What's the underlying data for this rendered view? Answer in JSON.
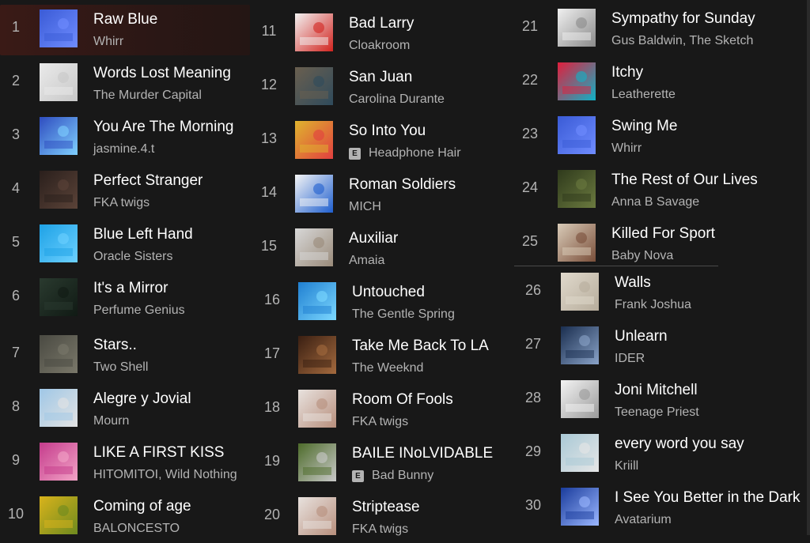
{
  "tracks": [
    {
      "num": "1",
      "title": "Raw Blue",
      "artist": "Whirr",
      "art": "blue-dancer-art",
      "colors": [
        "#3a5bd6",
        "#6f8cff"
      ],
      "active": true
    },
    {
      "num": "2",
      "title": "Words Lost Meaning",
      "artist": "The Murder Capital",
      "art": "white-map-art",
      "colors": [
        "#eaeaea",
        "#c8c8c8"
      ]
    },
    {
      "num": "3",
      "title": "You Are The Morning",
      "artist": "jasmine.4.t",
      "art": "blue-portrait-art",
      "colors": [
        "#2e4cbf",
        "#7fd0ff"
      ]
    },
    {
      "num": "4",
      "title": "Perfect Stranger",
      "artist": "FKA twigs",
      "art": "dark-figure-art",
      "colors": [
        "#2a1f1c",
        "#5b4338"
      ]
    },
    {
      "num": "5",
      "title": "Blue Left Hand",
      "artist": "Oracle Sisters",
      "art": "cyan-logo-art",
      "colors": [
        "#1ea2e6",
        "#6cd0ff"
      ]
    },
    {
      "num": "6",
      "title": "It's a Mirror",
      "artist": "Perfume Genius",
      "art": "night-room-art",
      "colors": [
        "#2a3a2f",
        "#101a14"
      ]
    },
    {
      "num": "7",
      "title": "Stars..",
      "artist": "Two Shell",
      "art": "gray-rock-art",
      "colors": [
        "#4a4a42",
        "#7a786a"
      ]
    },
    {
      "num": "8",
      "title": "Alegre y Jovial",
      "artist": "Mourn",
      "art": "sky-stairs-art",
      "colors": [
        "#9fc7e6",
        "#e3e3e3"
      ]
    },
    {
      "num": "9",
      "title": "LIKE A FIRST KISS",
      "artist": "HITOMITOI, Wild Nothing",
      "art": "pink-portrait-art",
      "colors": [
        "#c53c8c",
        "#f2a3c6"
      ]
    },
    {
      "num": "10",
      "title": "Coming of age",
      "artist": "BALONCESTO",
      "art": "yellow-flowers-art",
      "colors": [
        "#d9b31b",
        "#6e8a1f"
      ]
    },
    {
      "num": "11",
      "title": "Bad Larry",
      "artist": "Cloakroom",
      "art": "red-dot-art",
      "colors": [
        "#f2f2f2",
        "#d2241f"
      ]
    },
    {
      "num": "12",
      "title": "San Juan",
      "artist": "Carolina Durante",
      "art": "collage-art",
      "colors": [
        "#6a5f4f",
        "#2f4b5c"
      ]
    },
    {
      "num": "13",
      "title": "So Into You",
      "artist": "Headphone Hair",
      "art": "glasses-art",
      "colors": [
        "#e0b42e",
        "#e13f3f"
      ],
      "explicit": true
    },
    {
      "num": "14",
      "title": "Roman Soldiers",
      "artist": "MICH",
      "art": "blue-shapes-art",
      "colors": [
        "#f5f5f5",
        "#1f5fcf"
      ]
    },
    {
      "num": "15",
      "title": "Auxiliar",
      "artist": "Amaia",
      "art": "bedroom-art",
      "colors": [
        "#d8d8d8",
        "#9a8b7a"
      ]
    },
    {
      "num": "16",
      "title": "Untouched",
      "artist": "The Gentle Spring",
      "art": "water-art",
      "colors": [
        "#1f7fd1",
        "#7cd8ff"
      ]
    },
    {
      "num": "17",
      "title": "Take Me Back To LA",
      "artist": "The Weeknd",
      "art": "dark-face-art",
      "colors": [
        "#3a1f12",
        "#a46a3e"
      ]
    },
    {
      "num": "18",
      "title": "Room Of Fools",
      "artist": "FKA twigs",
      "art": "eusexua-art",
      "colors": [
        "#e8e2de",
        "#b88f7d"
      ]
    },
    {
      "num": "19",
      "title": "BAILE INoLVIDABLE",
      "artist": "Bad Bunny",
      "art": "garden-chairs-art",
      "colors": [
        "#4d6b2a",
        "#c9c9c9"
      ],
      "explicit": true
    },
    {
      "num": "20",
      "title": "Striptease",
      "artist": "FKA twigs",
      "art": "eusexua-art",
      "colors": [
        "#e8e2de",
        "#b88f7d"
      ]
    },
    {
      "num": "21",
      "title": "Sympathy for Sunday",
      "artist": "Gus Baldwin, The Sketch",
      "art": "bw-group-art",
      "colors": [
        "#f0f0f0",
        "#8a8a8a"
      ]
    },
    {
      "num": "22",
      "title": "Itchy",
      "artist": "Leatherette",
      "art": "red-lips-art",
      "colors": [
        "#e11e3c",
        "#0fb2c6"
      ]
    },
    {
      "num": "23",
      "title": "Swing Me",
      "artist": "Whirr",
      "art": "blue-dancer-art",
      "colors": [
        "#3a5bd6",
        "#6f8cff"
      ]
    },
    {
      "num": "24",
      "title": "The Rest of Our Lives",
      "artist": "Anna B Savage",
      "art": "foliage-face-art",
      "colors": [
        "#2f3a1c",
        "#6b7a3f"
      ]
    },
    {
      "num": "25",
      "title": "Killed For Sport",
      "artist": "Baby Nova",
      "art": "portrait-art",
      "colors": [
        "#d9cbb8",
        "#7a4f3a"
      ]
    },
    {
      "num": "26",
      "title": "Walls",
      "artist": "Frank Joshua",
      "art": "beige-pattern-art",
      "colors": [
        "#e0d9cc",
        "#b7ad9c"
      ]
    },
    {
      "num": "27",
      "title": "Unlearn",
      "artist": "IDER",
      "art": "navy-figures-art",
      "colors": [
        "#1a2e4f",
        "#8aa3c8"
      ]
    },
    {
      "num": "28",
      "title": "Joni Mitchell",
      "artist": "Teenage Priest",
      "art": "white-pendant-art",
      "colors": [
        "#f4f4f4",
        "#9a9a9a"
      ]
    },
    {
      "num": "29",
      "title": "every word you say",
      "artist": "Kriill",
      "art": "pale-blue-art",
      "colors": [
        "#a9c9d6",
        "#e6e6e6"
      ]
    },
    {
      "num": "30",
      "title": "I See You Better in the Dark",
      "artist": "Avatarium",
      "art": "blue-globe-art",
      "colors": [
        "#1a3c9c",
        "#9bb7ff"
      ]
    }
  ],
  "explicit_label": "E"
}
